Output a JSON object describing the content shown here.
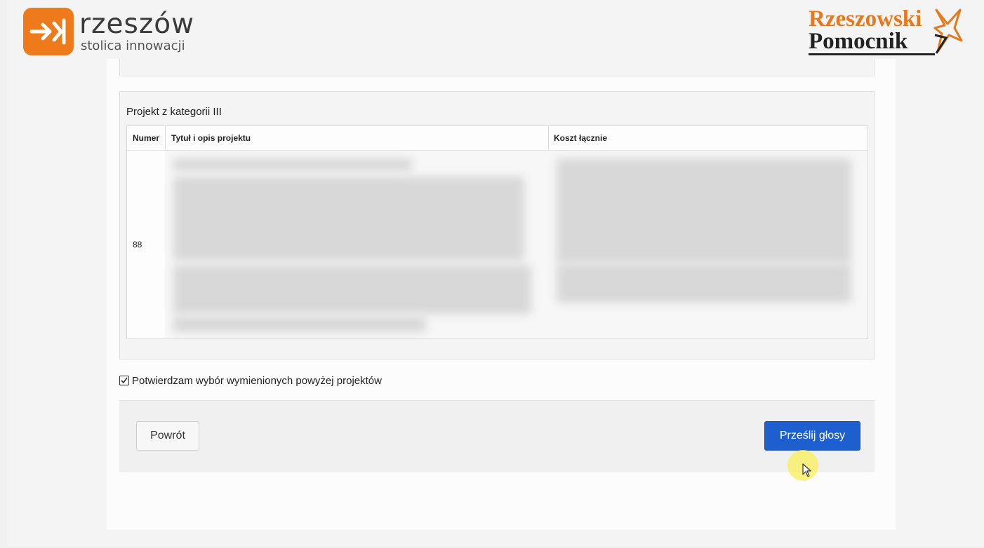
{
  "header": {
    "logo_left": {
      "title": "rzeszów",
      "subtitle": "stolica innowacji"
    },
    "logo_right": {
      "line1": "Rzeszowski",
      "line2": "Pomocnik"
    }
  },
  "category_section": {
    "title": "Projekt z kategorii III",
    "table": {
      "columns": [
        "Numer",
        "Tytuł i opis projektu",
        "Koszt łącznie"
      ],
      "rows": [
        {
          "number": "88"
        }
      ]
    }
  },
  "confirm": {
    "label": "Potwierdzam wybór wymienionych powyżej projektów",
    "checked": true
  },
  "actions": {
    "back_label": "Powrót",
    "submit_label": "Prześlij głosy"
  },
  "colors": {
    "accent_orange": "#ee7a1c",
    "submit_blue": "#1e5fd0",
    "cursor_highlight": "#faf05a"
  }
}
